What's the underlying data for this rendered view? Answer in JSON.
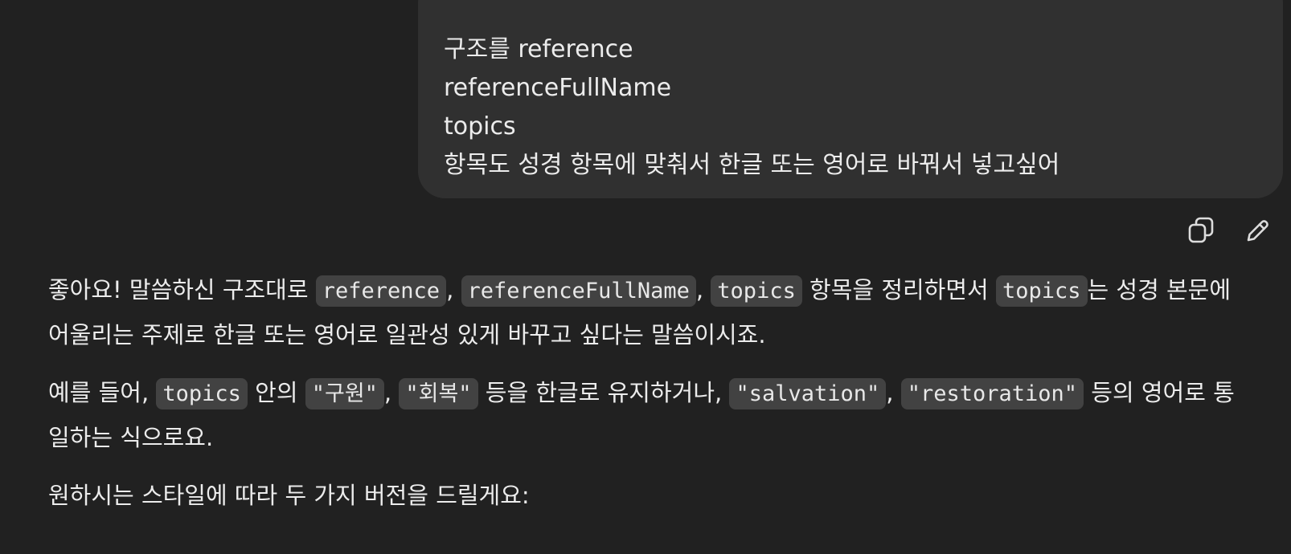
{
  "user_message": {
    "lines": [
      "구조를 reference",
      "referenceFullName",
      "topics",
      "항목도 성경 항목에 맞춰서 한글 또는 영어로 바꿔서 넣고싶어"
    ]
  },
  "actions": {
    "copy_icon": "copy-icon",
    "edit_icon": "pencil-icon"
  },
  "assistant_message": {
    "p1": {
      "t1": "좋아요! 말씀하신 구조대로 ",
      "c1": "reference",
      "t2": ", ",
      "c2": "referenceFullName",
      "t3": ", ",
      "c3": "topics",
      "t4": " 항목을 정리하면서 ",
      "c4": "topics",
      "t5": "는 성경 본문에",
      "t6": "어울리는 주제로 한글 또는 영어로 일관성 있게 바꾸고 싶다는 말씀이시죠."
    },
    "p2": {
      "t1": "예를 들어, ",
      "c1": "topics",
      "t2": " 안의 ",
      "c2": "\"구원\"",
      "t3": ", ",
      "c3": "\"회복\"",
      "t4": " 등을 한글로 유지하거나, ",
      "c4": "\"salvation\"",
      "t5": ", ",
      "c5": "\"restoration\"",
      "t6": " 등의 영어로 통",
      "t7": "일하는 식으로요."
    },
    "p3": {
      "t1": "원하시는 스타일에 따라 두 가지 버전을 드릴게요:"
    }
  }
}
